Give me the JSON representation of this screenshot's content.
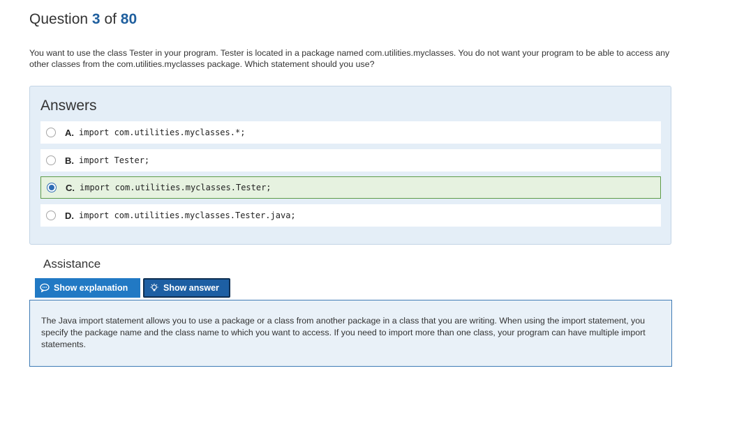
{
  "question": {
    "prefix": "Question",
    "number": "3",
    "of_label": "of",
    "total": "80",
    "text": "You want to use the class Tester in your program. Tester is located in a package named com.utilities.myclasses. You do not want your program to be able to access any other classes from the com.utilities.myclasses package. Which statement should you use?"
  },
  "answers": {
    "title": "Answers",
    "options": [
      {
        "letter": "A.",
        "code": "import com.utilities.myclasses.*;",
        "selected": false
      },
      {
        "letter": "B.",
        "code": "import Tester;",
        "selected": false
      },
      {
        "letter": "C.",
        "code": "import com.utilities.myclasses.Tester;",
        "selected": true
      },
      {
        "letter": "D.",
        "code": "import com.utilities.myclasses.Tester.java;",
        "selected": false
      }
    ]
  },
  "assistance": {
    "title": "Assistance",
    "show_explanation_label": "Show explanation",
    "show_answer_label": "Show answer",
    "explanation_text": "The Java import statement allows you to use a package or a class from another package in a class that you are writing. When using the import statement, you specify the package name and the class name to which you want to access. If you need to import more than one class, your program can have multiple import statements."
  },
  "icons": {
    "explanation": "speech-bubble-icon",
    "answer": "lightbulb-icon"
  },
  "colors": {
    "accent": "#1f5f9e",
    "panel_bg": "#e4eef7",
    "selected_bg": "#e6f2e0",
    "selected_border": "#5e9b48",
    "tab_primary": "#2179c4",
    "tab_active": "#1d5fa3"
  }
}
